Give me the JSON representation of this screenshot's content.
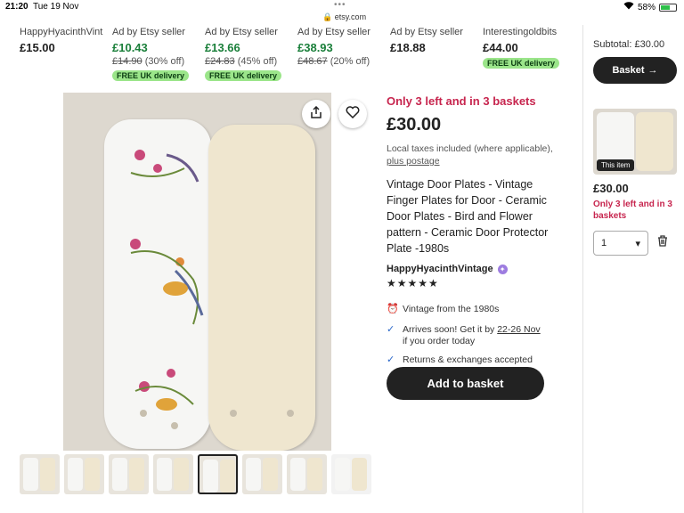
{
  "status_bar": {
    "time": "21:20",
    "date": "Tue 19 Nov",
    "url": "etsy.com",
    "battery": "58%"
  },
  "carousel": [
    {
      "seller": "HappyHyacinthVint",
      "price": "£15.00",
      "old_price": "",
      "discount": "",
      "badge": ""
    },
    {
      "seller": "Ad by Etsy seller",
      "price": "£10.43",
      "old_price": "£14.90",
      "discount": "(30% off)",
      "badge": "FREE UK delivery"
    },
    {
      "seller": "Ad by Etsy seller",
      "price": "£13.66",
      "old_price": "£24.83",
      "discount": "(45% off)",
      "badge": "FREE UK delivery"
    },
    {
      "seller": "Ad by Etsy seller",
      "price": "£38.93",
      "old_price": "£48.67",
      "discount": "(20% off)",
      "badge": ""
    },
    {
      "seller": "Ad by Etsy seller",
      "price": "£18.88",
      "old_price": "",
      "discount": "",
      "badge": ""
    },
    {
      "seller": "Interestingoldbits",
      "price": "£44.00",
      "old_price": "",
      "discount": "",
      "badge": "FREE UK delivery"
    }
  ],
  "product": {
    "stock": "Only 3 left and in 3 baskets",
    "price": "£30.00",
    "taxes": "Local taxes included (where applicable),",
    "postage_link": "plus postage",
    "title": "Vintage Door Plates - Vintage Finger Plates for Door - Ceramic Door Plates - Bird and Flower pattern - Ceramic Door Protector Plate -1980s",
    "shop": "HappyHyacinthVintage",
    "stars": "★★★★★",
    "features": {
      "vintage": "Vintage from the 1980s",
      "arrives": "Arrives soon! Get it by",
      "arrives_date": "22-26 Nov",
      "arrives_suffix": "if you order today",
      "returns": "Returns & exchanges accepted"
    },
    "add_to_basket": "Add to basket"
  },
  "panel": {
    "subtotal": "Subtotal: £30.00",
    "basket_button": "Basket",
    "this_item": "This item",
    "price": "£30.00",
    "stock": "Only 3 left and in 3 baskets",
    "quantity": "1"
  },
  "colors": {
    "accent_red": "#c7254e",
    "sale_green": "#1a7f3a",
    "badge_green": "#9be58a",
    "dark": "#222222"
  }
}
